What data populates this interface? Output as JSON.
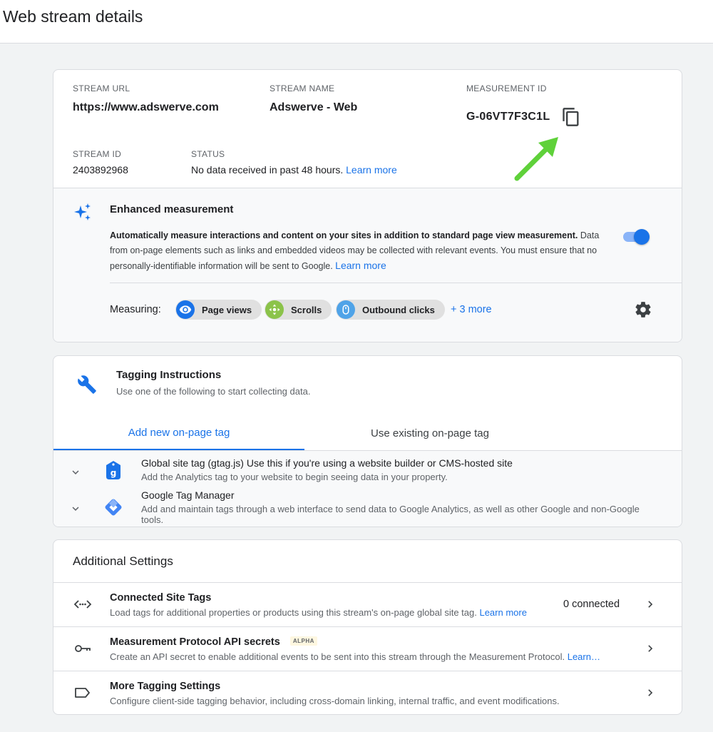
{
  "page": {
    "title": "Web stream details"
  },
  "stream": {
    "url_label": "STREAM URL",
    "url_value": "https://www.adswerve.com",
    "name_label": "STREAM NAME",
    "name_value": "Adswerve - Web",
    "measurement_label": "MEASUREMENT ID",
    "measurement_value": "G-06VT7F3C1L",
    "id_label": "STREAM ID",
    "id_value": "2403892968",
    "status_label": "STATUS",
    "status_value": "No data received in past 48 hours.",
    "status_link": "Learn more"
  },
  "enhanced": {
    "title": "Enhanced measurement",
    "desc_bold": "Automatically measure interactions and content on your sites in addition to standard page view measurement.",
    "desc_rest": "Data from on-page elements such as links and embedded videos may be collected with relevant events. You must ensure that no personally-identifiable information will be sent to Google.",
    "link": "Learn more",
    "toggle_on": true,
    "measuring_label": "Measuring:",
    "chips": [
      "Page views",
      "Scrolls",
      "Outbound clicks"
    ],
    "more_link": "+ 3 more"
  },
  "tagging": {
    "title": "Tagging Instructions",
    "subtitle": "Use one of the following to start collecting data.",
    "tabs": [
      "Add new on-page tag",
      "Use existing on-page tag"
    ],
    "items": [
      {
        "title": "Global site tag (gtag.js)",
        "title_rest": "Use this if you're using a website builder or CMS-hosted site",
        "desc": "Add the Analytics tag to your website to begin seeing data in your property."
      },
      {
        "title": "Google Tag Manager",
        "title_rest": "",
        "desc": "Add and maintain tags through a web interface to send data to Google Analytics, as well as other Google and non-Google tools."
      }
    ]
  },
  "additional": {
    "title": "Additional Settings",
    "rows": [
      {
        "name": "Connected Site Tags",
        "desc": "Load tags for additional properties or products using this stream's on-page global site tag.",
        "link": "Learn more",
        "right": "0 connected"
      },
      {
        "name": "Measurement Protocol API secrets",
        "badge": "ALPHA",
        "desc": "Create an API secret to enable additional events to be sent into this stream through the Measurement Protocol.",
        "link": "Learn…"
      },
      {
        "name": "More Tagging Settings",
        "desc": "Configure client-side tagging behavior, including cross-domain linking, internal traffic, and event modifications."
      }
    ]
  },
  "colors": {
    "accent": "#1a73e8",
    "arrow": "#5fd13a",
    "chip_pageviews": "#1a73e8",
    "chip_scrolls": "#8bc34a",
    "chip_outbound": "#4fa3e8"
  },
  "icons": [
    "copy-icon",
    "sparkle-icon",
    "eye-icon",
    "scroll-icon",
    "mouse-icon",
    "gear-icon",
    "wrench-icon",
    "chevron-down-icon",
    "gtag-icon",
    "gtm-icon",
    "code-icon",
    "key-icon",
    "label-icon",
    "chevron-right-icon"
  ]
}
